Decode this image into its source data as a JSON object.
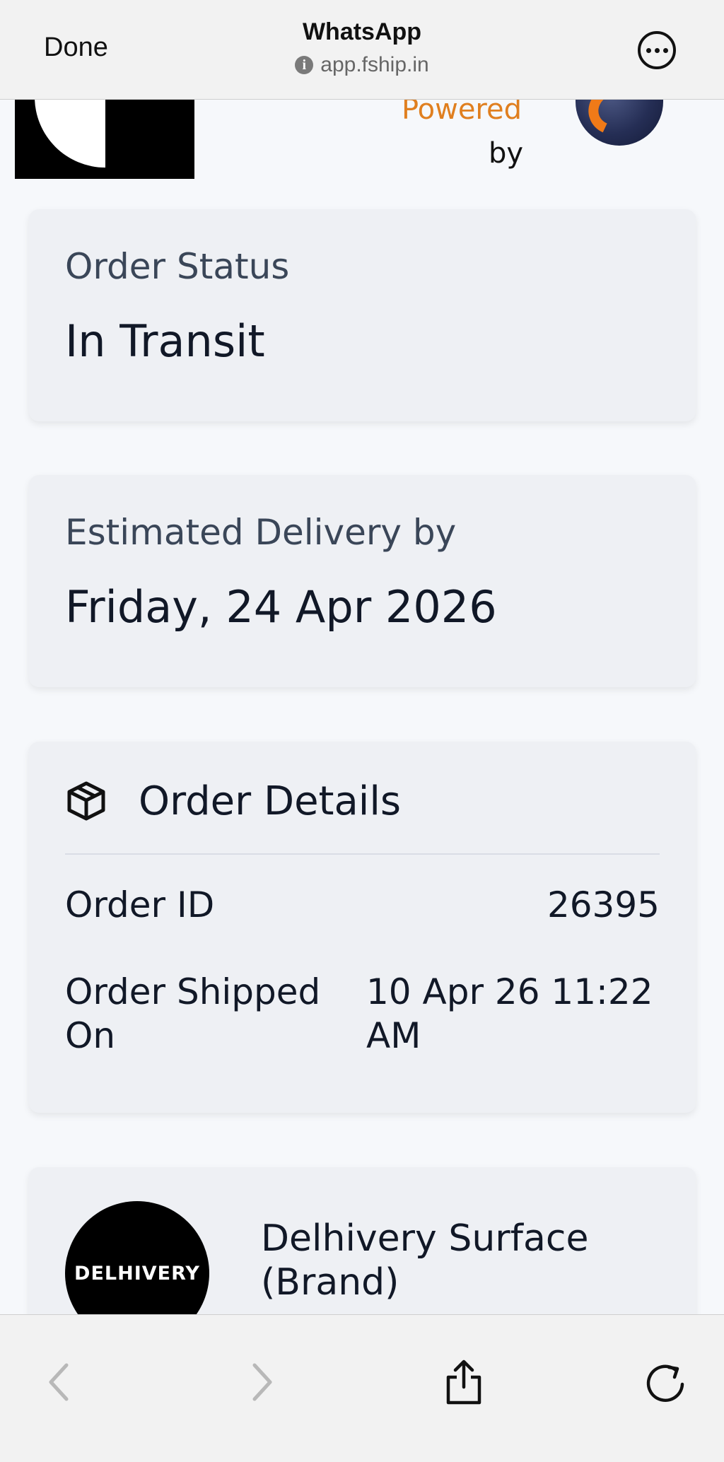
{
  "browser": {
    "done_label": "Done",
    "app_title": "WhatsApp",
    "url": "app.fship.in",
    "info_icon": "i"
  },
  "header": {
    "powered_text": "Powered",
    "by_text": "by"
  },
  "order_status": {
    "label": "Order Status",
    "value": "In Transit"
  },
  "delivery": {
    "label": "Estimated Delivery by",
    "value": "Friday, 24 Apr 2026"
  },
  "order_details": {
    "title": "Order Details",
    "rows": [
      {
        "label": "Order ID",
        "value": "26395"
      },
      {
        "label_line1": "Order Shipped",
        "label_line2": "On",
        "value_line1": "10 Apr 26 11:22",
        "value_line2": "AM"
      }
    ]
  },
  "courier": {
    "logo_text": "DELHIVERY",
    "name_line1": "Delhivery Surface",
    "name_line2": "(Brand)"
  },
  "colors": {
    "accent_orange": "#e07f1f",
    "card_bg": "#eef0f4",
    "page_bg": "#f6f8fb"
  }
}
